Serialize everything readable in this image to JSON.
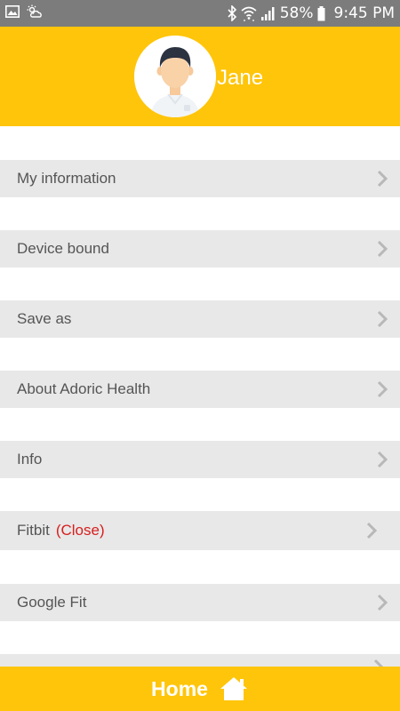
{
  "status_bar": {
    "battery": "58%",
    "time": "9:45 PM",
    "icons": [
      "gallery-icon",
      "weather-icon",
      "bluetooth-icon",
      "wifi-icon",
      "signal-icon",
      "battery-icon"
    ]
  },
  "header": {
    "user_name": "Jane",
    "background_color": "#ffc50a"
  },
  "menu": {
    "items": [
      {
        "label": "My information"
      },
      {
        "label": "Device bound"
      },
      {
        "label": "Save as"
      },
      {
        "label": "About Adoric Health"
      },
      {
        "label": "Info"
      },
      {
        "label": "Fitbit",
        "status": "(Close)",
        "status_color": "#d81e1e"
      },
      {
        "label": "Google Fit"
      },
      {
        "label": ""
      }
    ]
  },
  "bottom_bar": {
    "home_label": "Home",
    "icon": "home-icon"
  }
}
